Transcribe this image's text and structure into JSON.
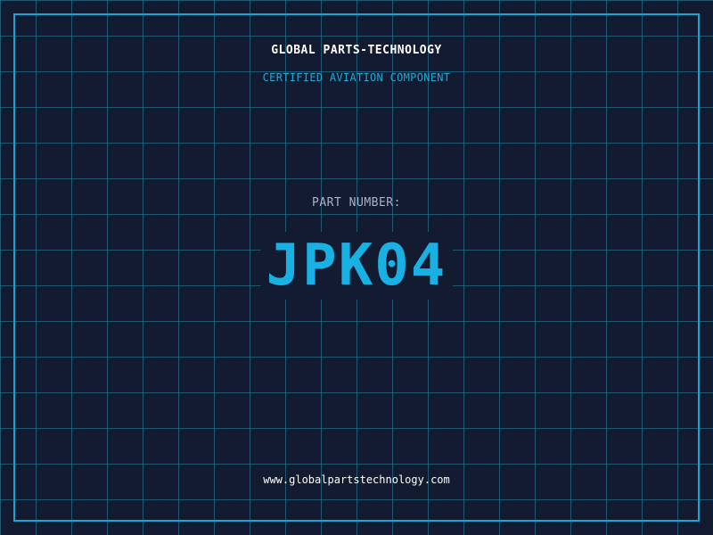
{
  "header": {
    "company": "GLOBAL PARTS-TECHNOLOGY",
    "tagline": "CERTIFIED AVIATION COMPONENT"
  },
  "part": {
    "label": "PART NUMBER:",
    "number": "JPK04"
  },
  "footer": {
    "website": "www.globalpartstechnology.com"
  },
  "colors": {
    "background": "#121b30",
    "grid": "#288caa",
    "frame": "#1ba6cf",
    "accent": "#19b1e4"
  }
}
